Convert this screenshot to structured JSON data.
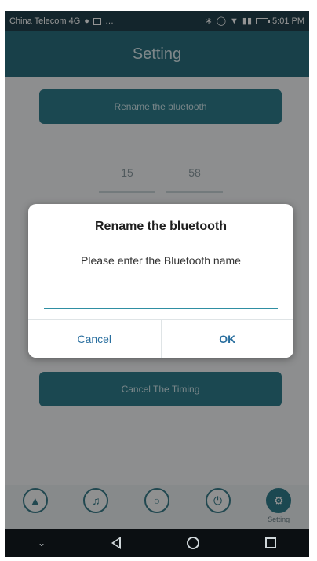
{
  "status_bar": {
    "carrier": "China Telecom 4G",
    "time": "5:01 PM"
  },
  "app_bar": {
    "title": "Setting"
  },
  "settings": {
    "rename_button": "Rename the bluetooth",
    "time_hours": "15",
    "time_minutes": "58",
    "cancel_timing_button": "Cancel The Timing"
  },
  "dialog": {
    "title": "Rename the bluetooth",
    "message": "Please enter the Bluetooth name",
    "input_value": "",
    "cancel_label": "Cancel",
    "ok_label": "OK"
  },
  "bottom_nav": {
    "items": [
      {
        "icon": "antenna-icon",
        "label": ""
      },
      {
        "icon": "music-icon",
        "label": ""
      },
      {
        "icon": "bulb-icon",
        "label": ""
      },
      {
        "icon": "power-icon",
        "label": ""
      },
      {
        "icon": "gear-icon",
        "label": "Setting"
      }
    ]
  },
  "colors": {
    "header": "#2a6f7f",
    "button": "#2f7d8c",
    "accent": "#2f8fa3",
    "dialog_action": "#2a6f9f"
  }
}
